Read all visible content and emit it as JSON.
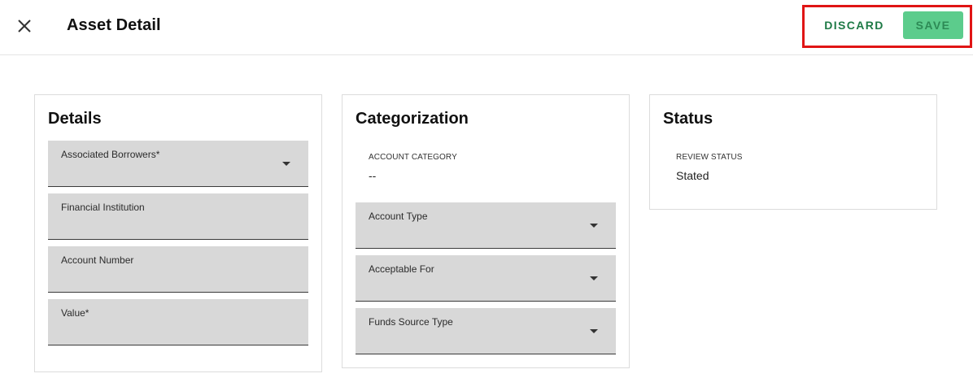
{
  "header": {
    "title": "Asset Detail",
    "discard_label": "DISCARD",
    "save_label": "SAVE"
  },
  "details": {
    "title": "Details",
    "fields": [
      {
        "label": "Associated Borrowers*",
        "type": "select"
      },
      {
        "label": "Financial Institution",
        "type": "text"
      },
      {
        "label": "Account Number",
        "type": "text"
      },
      {
        "label": "Value*",
        "type": "text"
      }
    ]
  },
  "categorization": {
    "title": "Categorization",
    "account_category_label": "ACCOUNT CATEGORY",
    "account_category_value": "--",
    "fields": [
      {
        "label": "Account Type",
        "type": "select"
      },
      {
        "label": "Acceptable For",
        "type": "select"
      },
      {
        "label": "Funds Source Type",
        "type": "select"
      }
    ]
  },
  "status": {
    "title": "Status",
    "review_status_label": "REVIEW STATUS",
    "review_status_value": "Stated"
  },
  "colors": {
    "accent_green": "#1e7a46",
    "save_bg": "#5ccc8c",
    "highlight_red": "#e01414",
    "field_bg": "#d8d8d8"
  },
  "icons": {
    "close": "close-icon",
    "dropdown": "chevron-down-icon"
  }
}
